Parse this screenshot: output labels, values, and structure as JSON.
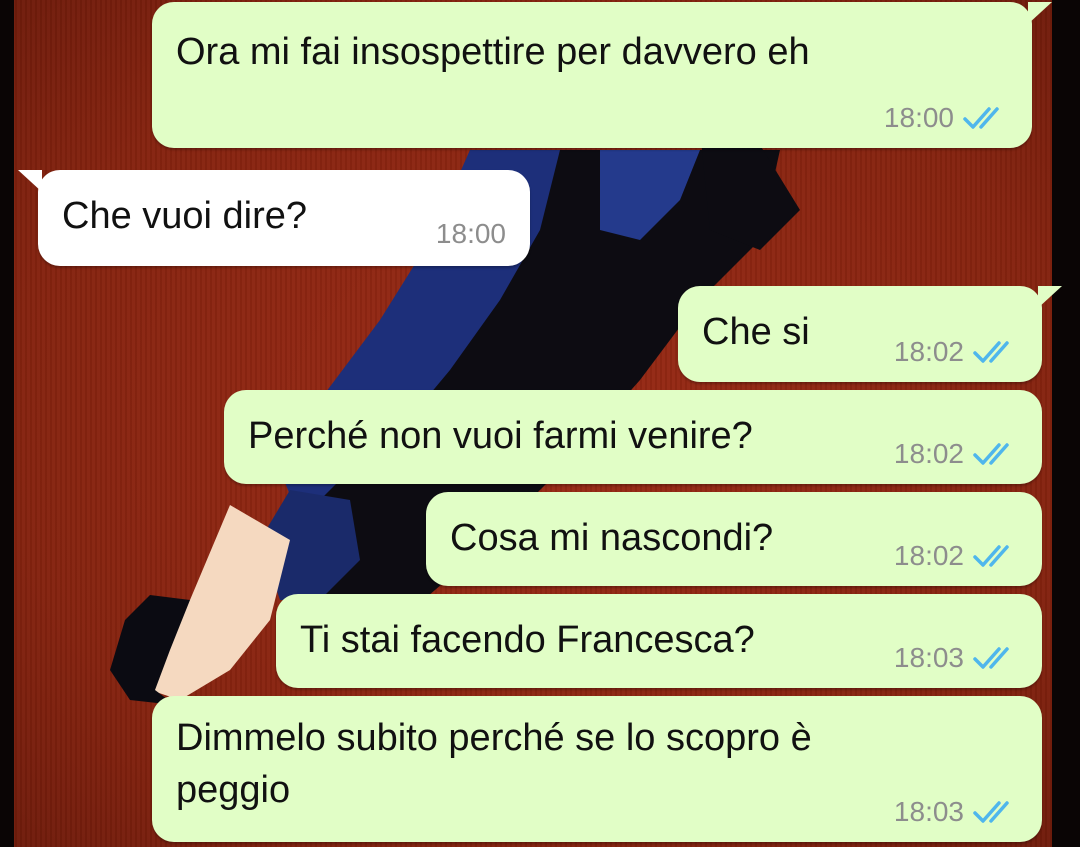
{
  "chat": {
    "colors": {
      "outgoing_bubble": "#e1fec6",
      "incoming_bubble": "#ffffff",
      "read_ticks": "#4fb6ec",
      "wallpaper": "#8a2412"
    },
    "messages": [
      {
        "direction": "outgoing",
        "text": "Ora mi fai insospettire per davvero eh",
        "time": "18:00",
        "status_icon": "double-check-read-icon"
      },
      {
        "direction": "incoming",
        "text": "Che vuoi dire?",
        "time": "18:00"
      },
      {
        "direction": "outgoing",
        "text": "Che si",
        "time": "18:02",
        "status_icon": "double-check-read-icon"
      },
      {
        "direction": "outgoing",
        "text": "Perché non vuoi farmi venire?",
        "time": "18:02",
        "status_icon": "double-check-read-icon"
      },
      {
        "direction": "outgoing",
        "text": "Cosa mi nascondi?",
        "time": "18:02",
        "status_icon": "double-check-read-icon"
      },
      {
        "direction": "outgoing",
        "text": "Ti stai facendo Francesca?",
        "time": "18:03",
        "status_icon": "double-check-read-icon"
      },
      {
        "direction": "outgoing",
        "text": "Dimmelo subito perché se lo scopro è\npeggio",
        "time": "18:03",
        "status_icon": "double-check-read-icon"
      }
    ]
  }
}
